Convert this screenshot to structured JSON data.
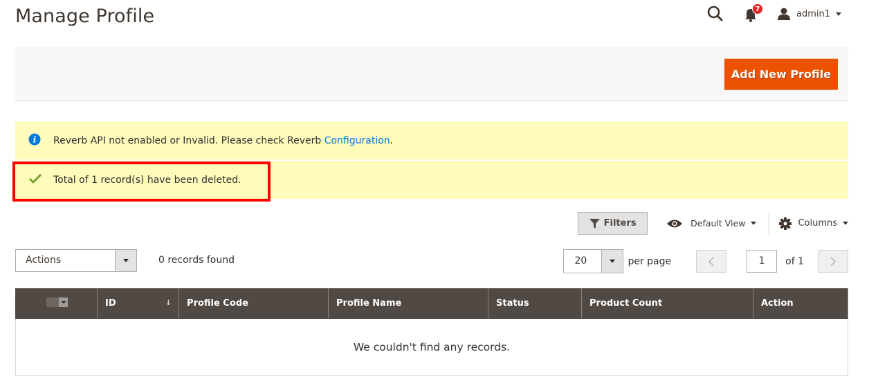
{
  "header": {
    "title": "Manage Profile",
    "notifications_count": "7",
    "username": "admin1"
  },
  "page_actions": {
    "add_button_label": "Add New Profile"
  },
  "messages": [
    {
      "type": "info",
      "icon": "info-icon",
      "text": "Reverb API not enabled or Invalid. Please check Reverb ",
      "link_text": "Configuration",
      "suffix": "."
    },
    {
      "type": "success",
      "icon": "check-icon",
      "text": "Total of 1 record(s) have been deleted."
    }
  ],
  "toolbar": {
    "filters_label": "Filters",
    "view_label": "Default View",
    "columns_label": "Columns",
    "actions_label": "Actions",
    "records_found": "0 records found",
    "per_page_value": "20",
    "per_page_label": "per page",
    "current_page": "1",
    "total_pages_label": "of 1"
  },
  "grid": {
    "columns": [
      "ID",
      "Profile Code",
      "Profile Name",
      "Status",
      "Product Count",
      "Action"
    ],
    "sort_indicator": "↓",
    "empty_text": "We couldn't find any records."
  },
  "colors": {
    "primary_button": "#eb5202",
    "message_bg": "#fffbbb",
    "grid_header_bg": "#514943",
    "link": "#007bdb",
    "highlight_border": "#ff0000",
    "badge": "#e22626"
  }
}
